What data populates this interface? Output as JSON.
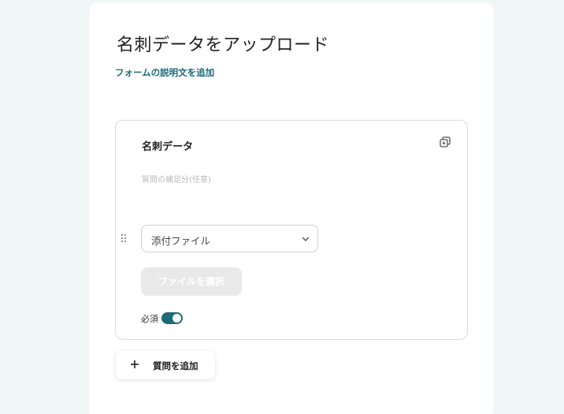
{
  "form": {
    "title": "名刺データをアップロード",
    "description_link": "フォームの説明文を追加"
  },
  "question": {
    "title": "名刺データ",
    "help_placeholder": "質問の補足分(任意)",
    "type_selected": "添付ファイル",
    "file_button_label": "ファイルを選択",
    "required_label": "必須",
    "required_on": true,
    "icons": {
      "copy": "copy-icon",
      "drag": "drag-handle-icon",
      "chevron": "chevron-down-icon"
    }
  },
  "add_question": {
    "label": "質問を追加",
    "icon": "plus-icon"
  },
  "colors": {
    "page_background": "#f0f8f7",
    "accent": "#1d6a7a"
  }
}
